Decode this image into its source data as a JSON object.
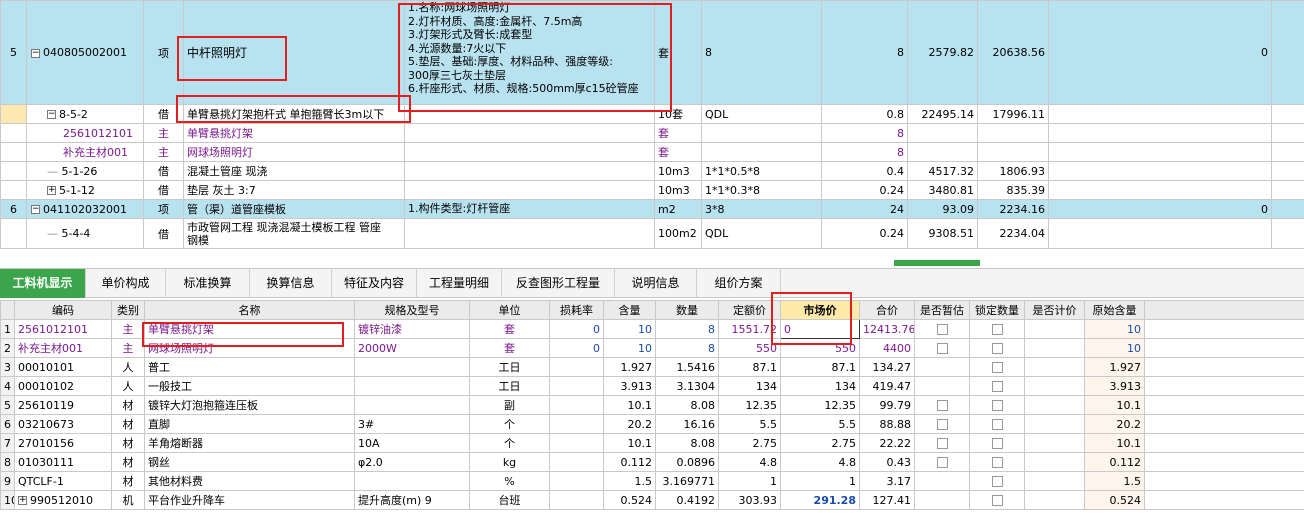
{
  "top_rows": [
    {
      "idx": "5",
      "code": "040805002001",
      "kind": "项",
      "name": "中杆照明灯",
      "desc": [
        "1.名称:网球场照明灯",
        "2.灯杆材质、高度:金属杆、7.5m高",
        "3.灯架形式及臂长:成套型",
        "4.光源数量:7火以下",
        "5.垫层、基础:厚度、材料品种、强度等级:",
        "300厚三七灰土垫层",
        "6.杆座形式、材质、规格:500mm厚c15砼管座"
      ],
      "unit": "套",
      "expr": "8",
      "qty": "8",
      "price": "2579.82",
      "total": "20638.56",
      "last": "0"
    },
    {
      "idx": "",
      "code": "8-5-2",
      "kind": "借",
      "name": "单臂悬挑灯架抱杆式 单抱箍臂长3m以下",
      "desc": [],
      "unit": "10套",
      "expr": "QDL",
      "qty": "0.8",
      "price": "22495.14",
      "total": "17996.11",
      "last": ""
    },
    {
      "idx": "",
      "code": "2561012101",
      "kind": "主",
      "name": "单臂悬挑灯架",
      "desc": [],
      "unit": "套",
      "expr": "",
      "qty": "8",
      "price": "",
      "total": "",
      "last": ""
    },
    {
      "idx": "",
      "code": "补充主材001",
      "kind": "主",
      "name": "网球场照明灯",
      "desc": [],
      "unit": "套",
      "expr": "",
      "qty": "8",
      "price": "",
      "total": "",
      "last": ""
    },
    {
      "idx": "",
      "code": "5-1-26",
      "kind": "借",
      "name": "混凝土管座 现浇",
      "desc": [],
      "unit": "10m3",
      "expr": "1*1*0.5*8",
      "qty": "0.4",
      "price": "4517.32",
      "total": "1806.93",
      "last": ""
    },
    {
      "idx": "",
      "code": "5-1-12",
      "kind": "借",
      "name": "垫层 灰土 3:7",
      "desc": [],
      "unit": "10m3",
      "expr": "1*1*0.3*8",
      "qty": "0.24",
      "price": "3480.81",
      "total": "835.39",
      "last": ""
    },
    {
      "idx": "6",
      "code": "041102032001",
      "kind": "项",
      "name": "管（渠）道管座模板",
      "desc": [
        "1.构件类型:灯杆管座"
      ],
      "unit": "m2",
      "expr": "3*8",
      "qty": "24",
      "price": "93.09",
      "total": "2234.16",
      "last": "0"
    },
    {
      "idx": "",
      "code": "5-4-4",
      "kind": "借",
      "name": "市政管网工程 现浇混凝土模板工程 管座",
      "name2": "钢模",
      "desc": [],
      "unit": "100m2",
      "expr": "QDL",
      "qty": "0.24",
      "price": "9308.51",
      "total": "2234.04",
      "last": ""
    }
  ],
  "tabs": [
    "工料机显示",
    "单价构成",
    "标准换算",
    "换算信息",
    "特征及内容",
    "工程量明细",
    "反查图形工程量",
    "说明信息",
    "组价方案"
  ],
  "headers": [
    "编码",
    "类别",
    "名称",
    "规格及型号",
    "单位",
    "损耗率",
    "含量",
    "数量",
    "定额价",
    "市场价",
    "合价",
    "是否暂估",
    "锁定数量",
    "是否计价",
    "原始含量"
  ],
  "rows": [
    {
      "n": "1",
      "code": "2561012101",
      "cat": "主",
      "name": "单臂悬挑灯架",
      "spec": "镀锌油漆",
      "unit": "套",
      "loss": "0",
      "content": "10",
      "qty": "8",
      "base": "1551.72",
      "market": "0",
      "sum": "12413.76",
      "orig": "10",
      "purple": true,
      "blueNums": true,
      "chk": [
        true,
        true,
        false
      ]
    },
    {
      "n": "2",
      "code": "补充主材001",
      "cat": "主",
      "name": "网球场照明灯",
      "spec": "2000W",
      "unit": "套",
      "loss": "0",
      "content": "10",
      "qty": "8",
      "base": "550",
      "market": "550",
      "sum": "4400",
      "orig": "10",
      "purple": true,
      "blueNums": true,
      "chk": [
        true,
        true,
        false
      ]
    },
    {
      "n": "3",
      "code": "00010101",
      "cat": "人",
      "name": "普工",
      "spec": "",
      "unit": "工日",
      "loss": "",
      "content": "1.927",
      "qty": "1.5416",
      "base": "87.1",
      "market": "87.1",
      "sum": "134.27",
      "orig": "1.927",
      "chk": [
        false,
        true,
        false
      ]
    },
    {
      "n": "4",
      "code": "00010102",
      "cat": "人",
      "name": "一般技工",
      "spec": "",
      "unit": "工日",
      "loss": "",
      "content": "3.913",
      "qty": "3.1304",
      "base": "134",
      "market": "134",
      "sum": "419.47",
      "orig": "3.913",
      "chk": [
        false,
        true,
        false
      ]
    },
    {
      "n": "5",
      "code": "25610119",
      "cat": "材",
      "name": "镀锌大灯泡抱箍连压板",
      "spec": "",
      "unit": "副",
      "loss": "",
      "content": "10.1",
      "qty": "8.08",
      "base": "12.35",
      "market": "12.35",
      "sum": "99.79",
      "orig": "10.1",
      "chk": [
        true,
        true,
        false
      ]
    },
    {
      "n": "6",
      "code": "03210673",
      "cat": "材",
      "name": "直脚",
      "spec": "3#",
      "unit": "个",
      "loss": "",
      "content": "20.2",
      "qty": "16.16",
      "base": "5.5",
      "market": "5.5",
      "sum": "88.88",
      "orig": "20.2",
      "chk": [
        true,
        true,
        false
      ]
    },
    {
      "n": "7",
      "code": "27010156",
      "cat": "材",
      "name": "羊角熔断器",
      "spec": "10A",
      "unit": "个",
      "loss": "",
      "content": "10.1",
      "qty": "8.08",
      "base": "2.75",
      "market": "2.75",
      "sum": "22.22",
      "orig": "10.1",
      "chk": [
        true,
        true,
        false
      ]
    },
    {
      "n": "8",
      "code": "01030111",
      "cat": "材",
      "name": "钢丝",
      "spec": "φ2.0",
      "unit": "kg",
      "loss": "",
      "content": "0.112",
      "qty": "0.0896",
      "base": "4.8",
      "market": "4.8",
      "sum": "0.43",
      "orig": "0.112",
      "chk": [
        true,
        true,
        false
      ]
    },
    {
      "n": "9",
      "code": "QTCLF-1",
      "cat": "材",
      "name": "其他材料费",
      "spec": "",
      "unit": "%",
      "loss": "",
      "content": "1.5",
      "qty": "3.169771",
      "base": "1",
      "market": "1",
      "sum": "3.17",
      "orig": "1.5",
      "chk": [
        false,
        true,
        false
      ]
    },
    {
      "n": "10",
      "code": "990512010",
      "cat": "机",
      "name": "平台作业升降车",
      "spec": "提升高度(m) 9",
      "unit": "台班",
      "loss": "",
      "content": "0.524",
      "qty": "0.4192",
      "base": "303.93",
      "market": "291.28",
      "sum": "127.41",
      "orig": "0.524",
      "marketBold": true,
      "expand": true,
      "chk": [
        false,
        true,
        false
      ]
    }
  ],
  "colors": {
    "selected_row": "#b8e2f0",
    "tab_active": "#3aa54a",
    "highlight_box": "#e02020",
    "purple": "#7a1a8c",
    "blue": "#1a4aa8"
  }
}
